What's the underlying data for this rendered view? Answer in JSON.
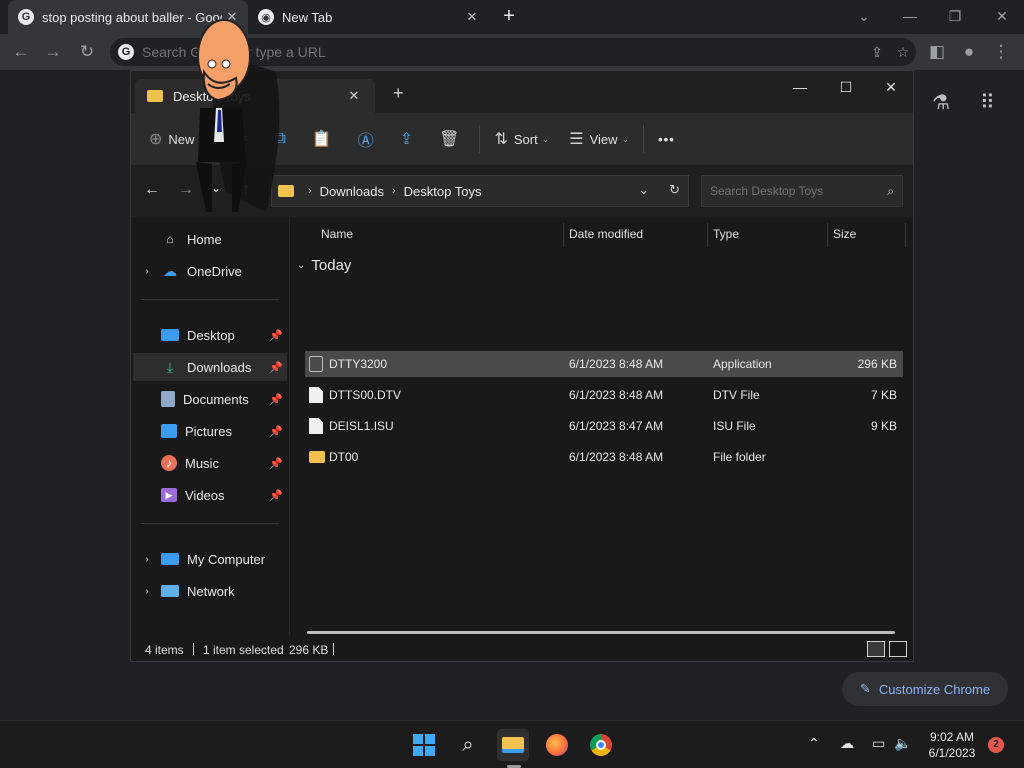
{
  "chrome": {
    "tabs": [
      {
        "title": "stop posting about baller - Google",
        "active": true
      },
      {
        "title": "New Tab",
        "active": false
      }
    ],
    "omnibox_placeholder": "Search Google or type a URL",
    "customize_label": "Customize Chrome"
  },
  "explorer": {
    "tab_title": "Desktop Toys",
    "commands": {
      "new": "New",
      "sort": "Sort",
      "view": "View",
      "more": "•••"
    },
    "breadcrumb": [
      "Downloads",
      "Desktop Toys"
    ],
    "search_placeholder": "Search Desktop Toys",
    "nav": {
      "home": "Home",
      "onedrive": "OneDrive",
      "desktop": "Desktop",
      "downloads": "Downloads",
      "documents": "Documents",
      "pictures": "Pictures",
      "music": "Music",
      "videos": "Videos",
      "my_computer": "My Computer",
      "network": "Network"
    },
    "columns": {
      "name": "Name",
      "date": "Date modified",
      "type": "Type",
      "size": "Size"
    },
    "group": "Today",
    "files": [
      {
        "name": "DTTY3200",
        "date": "6/1/2023 8:48 AM",
        "type": "Application",
        "size": "296 KB",
        "icon": "app",
        "selected": true
      },
      {
        "name": "DTTS00.DTV",
        "date": "6/1/2023 8:48 AM",
        "type": "DTV File",
        "size": "7 KB",
        "icon": "doc",
        "selected": false
      },
      {
        "name": "DEISL1.ISU",
        "date": "6/1/2023 8:47 AM",
        "type": "ISU File",
        "size": "9 KB",
        "icon": "doc",
        "selected": false
      },
      {
        "name": "DT00",
        "date": "6/1/2023 8:48 AM",
        "type": "File folder",
        "size": "",
        "icon": "folder",
        "selected": false
      }
    ],
    "status": {
      "items": "4 items",
      "selected": "1 item selected",
      "selected_size": "296 KB"
    }
  },
  "taskbar": {
    "time": "9:02 AM",
    "date": "6/1/2023",
    "notifications": "2"
  }
}
